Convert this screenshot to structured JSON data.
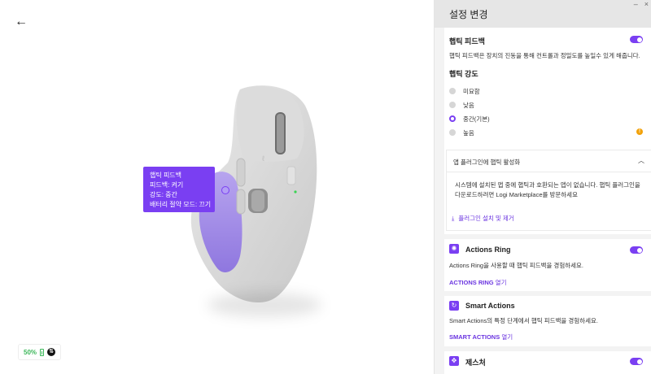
{
  "nav": {
    "back_icon": "←"
  },
  "tooltip": {
    "line1": "햅틱 피드백",
    "line2": "피드백: 켜기",
    "line3": "강도: 중간",
    "line4": "배터리 절약 모드: 끄기"
  },
  "battery": {
    "percent": "50%"
  },
  "panel": {
    "title": "설정 변경",
    "haptic": {
      "title": "햅틱 피드백",
      "desc": "햅틱 피드백은 장치의 진동을 통해 컨트롤과 정밀도를 높일수 있게 해줍니다.",
      "enabled": true
    },
    "intensity": {
      "title": "햅틱 강도",
      "options": [
        "미묘함",
        "낮음",
        "중간(기본)",
        "높음"
      ],
      "selected_index": 2
    },
    "plugin": {
      "header": "앱 플러그인에 햅틱 활성화",
      "body_line1": "시스템에 설치된 앱 중에 햅틱과 호환되는 앱이 없습니다. 햅틱 플러그인을",
      "body_line2": "다운로드하려면 Logi Marketplace를 방문하세요",
      "link": "플러그인 설치 및 제거"
    },
    "actions_ring": {
      "title": "Actions Ring",
      "desc": "Actions Ring을 사용할 때 햅틱 피드백을 경험하세요.",
      "link_bold": "ACTIONS RING",
      "link_rest": " 열기",
      "enabled": true
    },
    "smart_actions": {
      "title": "Smart Actions",
      "desc": "Smart Actions의 특정 단계에서 햅틱 피드백을 경험하세요.",
      "link_bold": "SMART ACTIONS",
      "link_rest": " 열기"
    },
    "gestures": {
      "title": "제스처",
      "enabled": true
    }
  },
  "colors": {
    "accent": "#7a3ff2",
    "battery_green": "#3cb75a",
    "warning": "#f2a20b"
  }
}
